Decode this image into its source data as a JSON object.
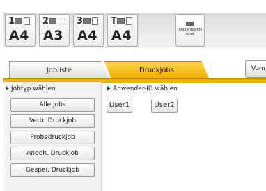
{
  "paper_trays": [
    {
      "number": "1",
      "size": "A4"
    },
    {
      "number": "2",
      "size": "A3"
    },
    {
      "number": "3",
      "size": "A4"
    },
    {
      "number": "T",
      "size": "A4"
    }
  ],
  "driver_button": {
    "label": "Treiber/Befehl verw."
  },
  "tabs": [
    {
      "label": "Jobliste",
      "selected": false
    },
    {
      "label": "Druckjobs",
      "selected": true
    }
  ],
  "side_button": {
    "label": "Vom"
  },
  "job_type": {
    "heading": "Jobtyp wählen",
    "buttons": [
      "Alle Jobs",
      "Vertr. Druckjob",
      "Probedruckjob",
      "Angeh. Druckjob",
      "Gespei. Druckjob"
    ]
  },
  "user_id": {
    "heading": "Anwender-ID wählen",
    "users": [
      "User1",
      "User2"
    ]
  },
  "colors": {
    "accent": "#f0b000",
    "panel": "#f2f2f2"
  }
}
